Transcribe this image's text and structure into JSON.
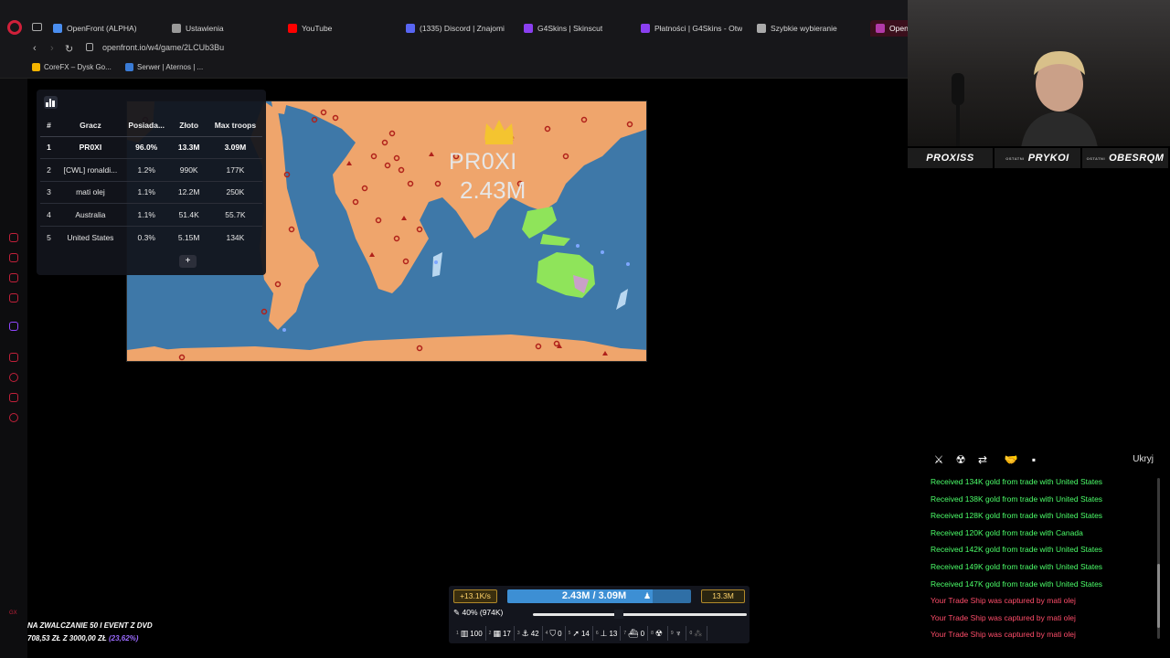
{
  "browser": {
    "tabs": [
      {
        "label": "OpenFront (ALPHA)",
        "color": "#4a8ef0"
      },
      {
        "label": "Ustawienia",
        "color": "#999999"
      },
      {
        "label": "YouTube",
        "color": "#ff0000"
      },
      {
        "label": "(1335) Discord | Znajomi",
        "color": "#5865f2"
      },
      {
        "label": "G4Skins | Skinscut",
        "color": "#8a3ff0"
      },
      {
        "label": "Płatności | G4Skins - Otw",
        "color": "#8a3ff0"
      },
      {
        "label": "Szybkie wybieranie",
        "color": "#aaaaaa"
      },
      {
        "label": "OpenF",
        "color": "#b23aa8"
      }
    ],
    "url": "openfront.io/w4/game/2LCUb3Bu",
    "bookmarks": [
      {
        "label": "CoreFX – Dysk Go...",
        "color": "#f4b400"
      },
      {
        "label": "Serwer | Aternos | ...",
        "color": "#3a7bd5"
      }
    ]
  },
  "leaderboard": {
    "headers": [
      "#",
      "Gracz",
      "Posiada...",
      "Złoto",
      "Max troops"
    ],
    "rows": [
      {
        "rank": "1",
        "player": "PR0XI",
        "owned": "96.0%",
        "gold": "13.3M",
        "troops": "3.09M"
      },
      {
        "rank": "2",
        "player": "[CWL] ronaldi...",
        "owned": "1.2%",
        "gold": "990K",
        "troops": "177K"
      },
      {
        "rank": "3",
        "player": "mati olej",
        "owned": "1.1%",
        "gold": "12.2M",
        "troops": "250K"
      },
      {
        "rank": "4",
        "player": "Australia",
        "owned": "1.1%",
        "gold": "51.4K",
        "troops": "55.7K"
      },
      {
        "rank": "5",
        "player": "United States",
        "owned": "0.3%",
        "gold": "5.15M",
        "troops": "134K"
      }
    ],
    "expand_label": "+"
  },
  "map": {
    "winner_name": "PR0XI",
    "winner_troops": "2.43M",
    "colors": {
      "ocean": "#3e78a8",
      "player": "#efa56c",
      "australia": "#8fe45a",
      "us": "#b9d7f0"
    }
  },
  "stream": {
    "labels": [
      {
        "sub": "",
        "name": "PROXISS"
      },
      {
        "sub": "OSTATNI",
        "name": "PRYKOI"
      },
      {
        "sub": "OSTATNI",
        "name": "OBESRQM"
      }
    ],
    "donation_line1": "NA ZWALCZANIE 50 I EVENT Z DVD",
    "donation_line2": "708,53 ZŁ  Z  3000,00 ZŁ",
    "donation_pct": "(23,62%)",
    "corner_tag": "GX"
  },
  "events": {
    "hide_label": "Ukryj",
    "toolbar_icons": [
      "sword-icon",
      "nuke-icon",
      "trade-icon",
      "alliance-icon",
      "chat-icon"
    ],
    "items": [
      {
        "text": "Received 134K gold from trade with United States",
        "color": "#4cff6a"
      },
      {
        "text": "Received 138K gold from trade with United States",
        "color": "#4cff6a"
      },
      {
        "text": "Received 128K gold from trade with United States",
        "color": "#4cff6a"
      },
      {
        "text": "Received 120K gold from trade with Canada",
        "color": "#4cff6a"
      },
      {
        "text": "Received 142K gold from trade with United States",
        "color": "#4cff6a"
      },
      {
        "text": "Received 149K gold from trade with United States",
        "color": "#4cff6a"
      },
      {
        "text": "Received 147K gold from trade with United States",
        "color": "#4cff6a"
      },
      {
        "text": "Your Trade Ship was captured by mati olej",
        "color": "#ff4d6a"
      },
      {
        "text": "Your Trade Ship was captured by mati olej",
        "color": "#ff4d6a"
      },
      {
        "text": "Your Trade Ship was captured by mati olej",
        "color": "#ff4d6a"
      }
    ]
  },
  "controls": {
    "gold_rate": "+13.1K/s",
    "troops": "2.43M / 3.09M",
    "troops_fraction": 0.79,
    "gold": "13.3M",
    "attack": "40% (974K)",
    "attack_fraction": 0.4,
    "buildings": [
      {
        "key": "1",
        "icon": "city-icon",
        "glyph": "▥",
        "count": "100"
      },
      {
        "key": "2",
        "icon": "factory-icon",
        "glyph": "▦",
        "count": "17"
      },
      {
        "key": "3",
        "icon": "port-icon",
        "glyph": "⚓",
        "count": "42"
      },
      {
        "key": "4",
        "icon": "defense-post-icon",
        "glyph": "⛉",
        "count": "0"
      },
      {
        "key": "5",
        "icon": "missile-silo-icon",
        "glyph": "➚",
        "count": "14"
      },
      {
        "key": "6",
        "icon": "sam-launcher-icon",
        "glyph": "⊥",
        "count": "13"
      },
      {
        "key": "7",
        "icon": "warship-icon",
        "glyph": "⛴",
        "count": "0"
      },
      {
        "key": "8",
        "icon": "atom-bomb-icon",
        "glyph": "☢",
        "count": ""
      },
      {
        "key": "9",
        "icon": "hydrogen-bomb-icon",
        "glyph": "♆",
        "count": ""
      },
      {
        "key": "0",
        "icon": "mirv-icon",
        "glyph": "⁂",
        "count": ""
      }
    ]
  }
}
